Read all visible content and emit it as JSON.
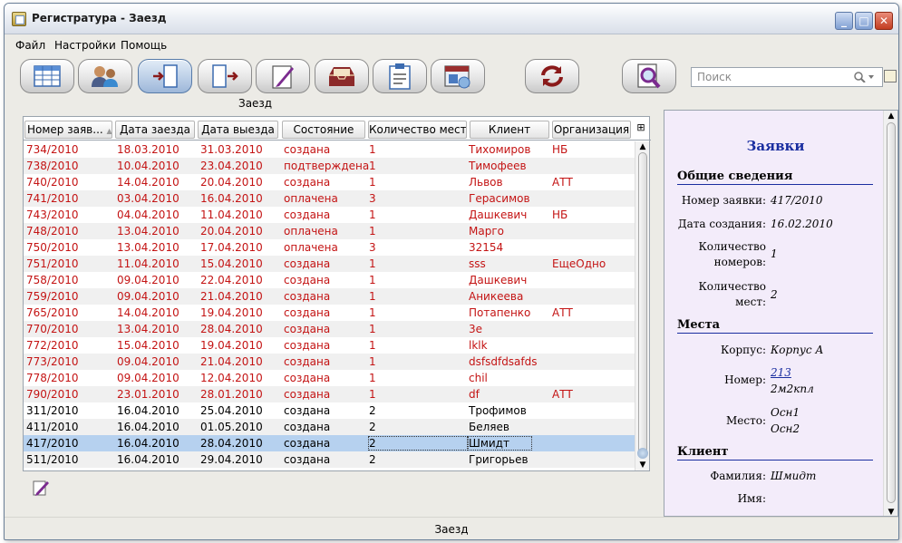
{
  "window": {
    "title": "Регистратура - Заезд",
    "controls": [
      "_",
      "□",
      "✕"
    ]
  },
  "menu": [
    "Файл",
    "Настройки",
    "Помощь"
  ],
  "toolbar": {
    "buttons": [
      {
        "icon": "table-icon"
      },
      {
        "icon": "users-icon"
      },
      {
        "icon": "check-in-icon",
        "active": true
      },
      {
        "icon": "check-out-icon"
      },
      {
        "icon": "edit-document-icon"
      },
      {
        "icon": "inbox-tray-icon"
      },
      {
        "icon": "clipboard-icon"
      },
      {
        "icon": "calendar-window-icon"
      },
      {
        "icon": "refresh-icon"
      },
      {
        "icon": "magnify-document-icon"
      }
    ],
    "caption": "Заезд",
    "search_placeholder": "Поиск"
  },
  "grid": {
    "columns": [
      "Номер заяв...",
      "Дата заезда",
      "Дата выезда",
      "Состояние",
      "Количество мест",
      "Клиент",
      "Организация"
    ],
    "rows": [
      {
        "num": "734/2010",
        "arr": "18.03.2010",
        "dep": "31.03.2010",
        "state": "создана",
        "places": "1",
        "client": "Тихомиров",
        "org": "НБ",
        "red": true
      },
      {
        "num": "738/2010",
        "arr": "10.04.2010",
        "dep": "23.04.2010",
        "state": "подтверждена",
        "places": "1",
        "client": "Тимофеев",
        "org": "",
        "red": true
      },
      {
        "num": "740/2010",
        "arr": "14.04.2010",
        "dep": "20.04.2010",
        "state": "создана",
        "places": "1",
        "client": "Львов",
        "org": "АТТ",
        "red": true
      },
      {
        "num": "741/2010",
        "arr": "03.04.2010",
        "dep": "16.04.2010",
        "state": "оплачена",
        "places": "3",
        "client": "Герасимов",
        "org": "",
        "red": true
      },
      {
        "num": "743/2010",
        "arr": "04.04.2010",
        "dep": "11.04.2010",
        "state": "создана",
        "places": "1",
        "client": "Дашкевич",
        "org": "НБ",
        "red": true
      },
      {
        "num": "748/2010",
        "arr": "13.04.2010",
        "dep": "20.04.2010",
        "state": "оплачена",
        "places": "1",
        "client": "Марго",
        "org": "",
        "red": true
      },
      {
        "num": "750/2010",
        "arr": "13.04.2010",
        "dep": "17.04.2010",
        "state": "оплачена",
        "places": "3",
        "client": "32154",
        "org": "",
        "red": true
      },
      {
        "num": "751/2010",
        "arr": "11.04.2010",
        "dep": "15.04.2010",
        "state": "создана",
        "places": "1",
        "client": "sss",
        "org": "ЕщеОдно",
        "red": true
      },
      {
        "num": "758/2010",
        "arr": "09.04.2010",
        "dep": "22.04.2010",
        "state": "создана",
        "places": "1",
        "client": "Дашкевич",
        "org": "",
        "red": true
      },
      {
        "num": "759/2010",
        "arr": "09.04.2010",
        "dep": "21.04.2010",
        "state": "создана",
        "places": "1",
        "client": "Аникеева",
        "org": "",
        "red": true
      },
      {
        "num": "765/2010",
        "arr": "14.04.2010",
        "dep": "19.04.2010",
        "state": "создана",
        "places": "1",
        "client": "Потапенко",
        "org": "АТТ",
        "red": true
      },
      {
        "num": "770/2010",
        "arr": "13.04.2010",
        "dep": "28.04.2010",
        "state": "создана",
        "places": "1",
        "client": "3е",
        "org": "",
        "red": true
      },
      {
        "num": "772/2010",
        "arr": "15.04.2010",
        "dep": "19.04.2010",
        "state": "создана",
        "places": "1",
        "client": "lklk",
        "org": "",
        "red": true
      },
      {
        "num": "773/2010",
        "arr": "09.04.2010",
        "dep": "21.04.2010",
        "state": "создана",
        "places": "1",
        "client": "dsfsdfdsafds",
        "org": "",
        "red": true
      },
      {
        "num": "778/2010",
        "arr": "09.04.2010",
        "dep": "12.04.2010",
        "state": "создана",
        "places": "1",
        "client": "chil",
        "org": "",
        "red": true
      },
      {
        "num": "790/2010",
        "arr": "23.01.2010",
        "dep": "28.01.2010",
        "state": "создана",
        "places": "1",
        "client": "df",
        "org": "АТТ",
        "red": true
      },
      {
        "num": "311/2010",
        "arr": "16.04.2010",
        "dep": "25.04.2010",
        "state": "создана",
        "places": "2",
        "client": "Трофимов",
        "org": "",
        "red": false
      },
      {
        "num": "411/2010",
        "arr": "16.04.2010",
        "dep": "01.05.2010",
        "state": "создана",
        "places": "2",
        "client": "Беляев",
        "org": "",
        "red": false
      },
      {
        "num": "417/2010",
        "arr": "16.04.2010",
        "dep": "28.04.2010",
        "state": "создана",
        "places": "2",
        "client": "Шмидт",
        "org": "",
        "red": false,
        "selected": true
      },
      {
        "num": "511/2010",
        "arr": "16.04.2010",
        "dep": "29.04.2010",
        "state": "создана",
        "places": "2",
        "client": "Григорьев",
        "org": "",
        "red": false
      }
    ]
  },
  "detail": {
    "title": "Заявки",
    "general_header": "Общие сведения",
    "order_number_label": "Номер заявки:",
    "order_number": "417/2010",
    "created_label": "Дата создания:",
    "created": "16.02.2010",
    "rooms_count_label_1": "Количество",
    "rooms_count_label_2": "номеров:",
    "rooms_count": "1",
    "places_count_label_1": "Количество",
    "places_count_label_2": "мест:",
    "places_count": "2",
    "places_header": "Места",
    "building_label": "Корпус:",
    "building": "Корпус А",
    "room_label": "Номер:",
    "room_link": "213",
    "room_type": "2м2кпл",
    "place_label": "Место:",
    "place_1": "Осн1",
    "place_2": "Осн2",
    "client_header": "Клиент",
    "surname_label": "Фамилия:",
    "surname": "Шмидт",
    "name_label": "Имя:"
  },
  "status": "Заезд",
  "colors": {
    "accent": "#1a2ea0",
    "red_text": "#c41414",
    "selected_row": "#b6d1ef"
  }
}
